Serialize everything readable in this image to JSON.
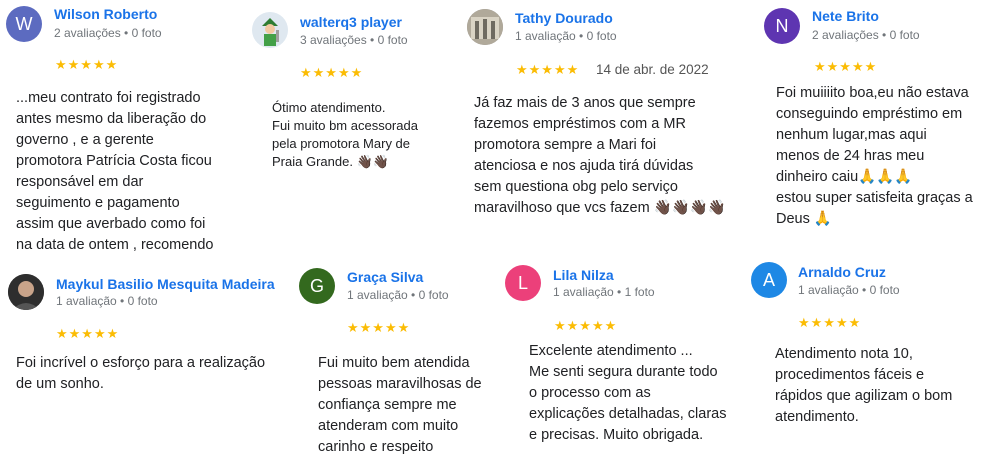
{
  "colors": {
    "link": "#1a73e8",
    "star": "#fbbc04",
    "meta": "#70757a"
  },
  "reviews": [
    {
      "name": "Wilson Roberto",
      "avatar": {
        "type": "letter",
        "letter": "W",
        "color": "#5c6bc0"
      },
      "meta": "2 avaliações • 0 foto",
      "stars": "★★★★★",
      "date": "",
      "text": "...meu contrato foi registrado\nantes mesmo da liberação do\ngoverno , e a gerente\npromotora Patrícia Costa ficou\nresponsável em dar\nseguimento e pagamento\nassim que averbado como foi\nna data de ontem , recomendo"
    },
    {
      "name": "walterq3 player",
      "avatar": {
        "type": "image",
        "icon": "game-character-avatar-icon"
      },
      "meta": "3 avaliações • 0 foto",
      "stars": "★★★★★",
      "date": "",
      "text": "Ótimo atendimento.\nFui muito bm acessorada\npela promotora Mary de\nPraia Grande. 👋🏿👋🏿"
    },
    {
      "name": "Tathy Dourado",
      "avatar": {
        "type": "image",
        "icon": "photo-avatar-icon"
      },
      "meta": "1 avaliação • 0 foto",
      "stars": "★★★★★",
      "date": "14 de abr. de 2022",
      "text": "Já faz mais de 3 anos que sempre\nfazemos empréstimos com a MR\npromotora sempre a Mari foi\natenciosa e nos ajuda tirá dúvidas\nsem questiona obg pelo serviço\nmaravilhoso que vcs fazem 👋🏿👋🏿👋🏿👋🏿"
    },
    {
      "name": "Nete Brito",
      "avatar": {
        "type": "letter",
        "letter": "N",
        "color": "#5e35b1"
      },
      "meta": "2 avaliações • 0 foto",
      "stars": "★★★★★",
      "date": "",
      "text": "Foi muiiiito boa,eu não estava\nconseguindo empréstimo em\nnenhum lugar,mas aqui\nmenos de 24 hras meu\ndinheiro caiu🙏🙏🙏\nestou super satisfeita graças a\nDeus 🙏"
    },
    {
      "name": "Maykul Basilio Mesquita Madeira",
      "avatar": {
        "type": "image",
        "icon": "photo-avatar-icon"
      },
      "meta": "1 avaliação • 0 foto",
      "stars": "★★★★★",
      "date": "",
      "text": "Foi incrível o esforço para a realização\nde um sonho."
    },
    {
      "name": "Graça Silva",
      "avatar": {
        "type": "letter",
        "letter": "G",
        "color": "#33691e"
      },
      "meta": "1 avaliação • 0 foto",
      "stars": "★★★★★",
      "date": "",
      "text": "Fui muito bem atendida\npessoas maravilhosas de\nconfiança sempre me\natenderam com muito\ncarinho e respeito"
    },
    {
      "name": "Lila Nilza",
      "avatar": {
        "type": "letter",
        "letter": "L",
        "color": "#ec407a"
      },
      "meta": "1 avaliação • 1 foto",
      "stars": "★★★★★",
      "date": "",
      "text": "Excelente atendimento ...\nMe senti segura durante todo\no processo com as\nexplicações detalhadas, claras\ne precisas. Muito obrigada."
    },
    {
      "name": "Arnaldo Cruz",
      "avatar": {
        "type": "letter",
        "letter": "A",
        "color": "#1e88e5"
      },
      "meta": "1 avaliação • 0 foto",
      "stars": "★★★★★",
      "date": "",
      "text": "Atendimento nota 10,\nprocedimentos fáceis e\nrápidos que agilizam o bom\natendimento."
    }
  ]
}
